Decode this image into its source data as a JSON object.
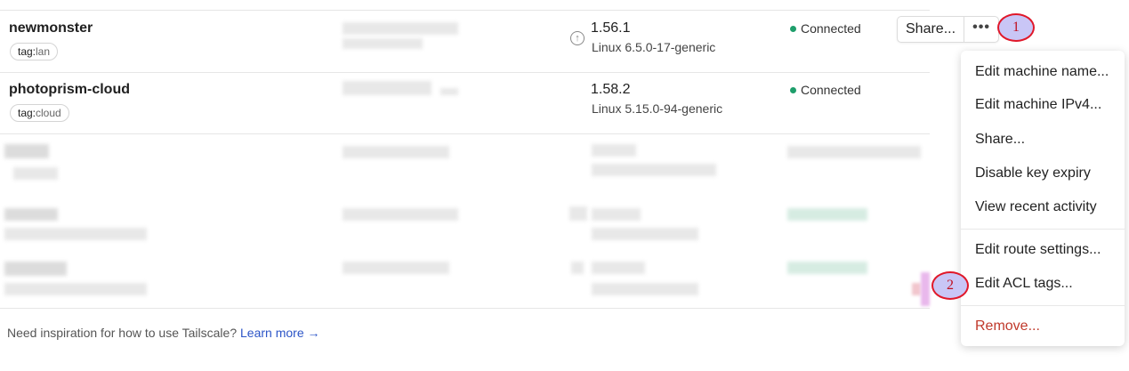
{
  "machines": [
    {
      "name": "newmonster",
      "tag_key": "tag:",
      "tag_value": "lan",
      "version": "1.56.1",
      "os": "Linux 6.5.0-17-generic",
      "status": "Connected",
      "update_icon": "arrow-up-circle-icon"
    },
    {
      "name": "photoprism-cloud",
      "tag_key": "tag:",
      "tag_value": "cloud",
      "version": "1.58.2",
      "os": "Linux 5.15.0-94-generic",
      "status": "Connected"
    }
  ],
  "actions": {
    "share_label": "Share...",
    "more_label": "•••",
    "more_icon": "more-horizontal-icon"
  },
  "badges": {
    "first": "1",
    "second": "2"
  },
  "menu": {
    "items": [
      "Edit machine name...",
      "Edit machine IPv4...",
      "Share...",
      "Disable key expiry",
      "View recent activity",
      "Edit route settings...",
      "Edit ACL tags...",
      "Remove..."
    ]
  },
  "footer": {
    "text": "Need inspiration for how to use Tailscale?",
    "link": "Learn more →"
  },
  "colors": {
    "connected": "#1e9e6b",
    "remove": "#c0392b",
    "link": "#2c55c7",
    "badge_border": "#e0182a",
    "badge_fill": "#c9c6f6"
  }
}
